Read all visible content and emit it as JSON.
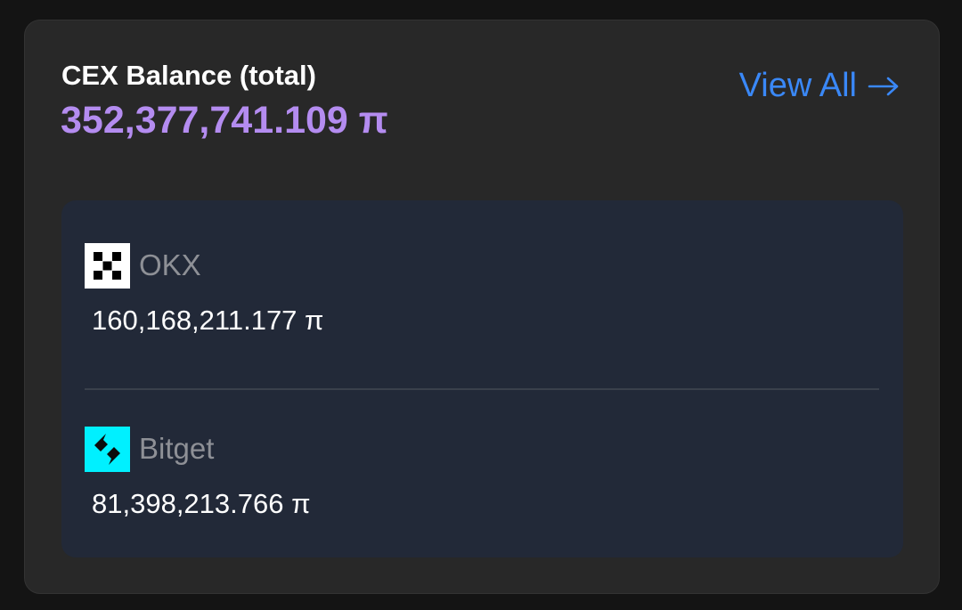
{
  "card": {
    "title": "CEX Balance (total)",
    "total_balance": "352,377,741.109 π",
    "view_all_label": "View All"
  },
  "exchanges": [
    {
      "name": "OKX",
      "balance": "160,168,211.177 π",
      "icon": "okx-logo-icon"
    },
    {
      "name": "Bitget",
      "balance": "81,398,213.766 π",
      "icon": "bitget-logo-icon"
    }
  ],
  "colors": {
    "background": "#141414",
    "card": "#282828",
    "panel": "#222938",
    "accent_total": "#b48cf0",
    "link": "#3a88f7",
    "exchange_name": "#8e9096",
    "bitget_brand": "#00f0ff"
  }
}
